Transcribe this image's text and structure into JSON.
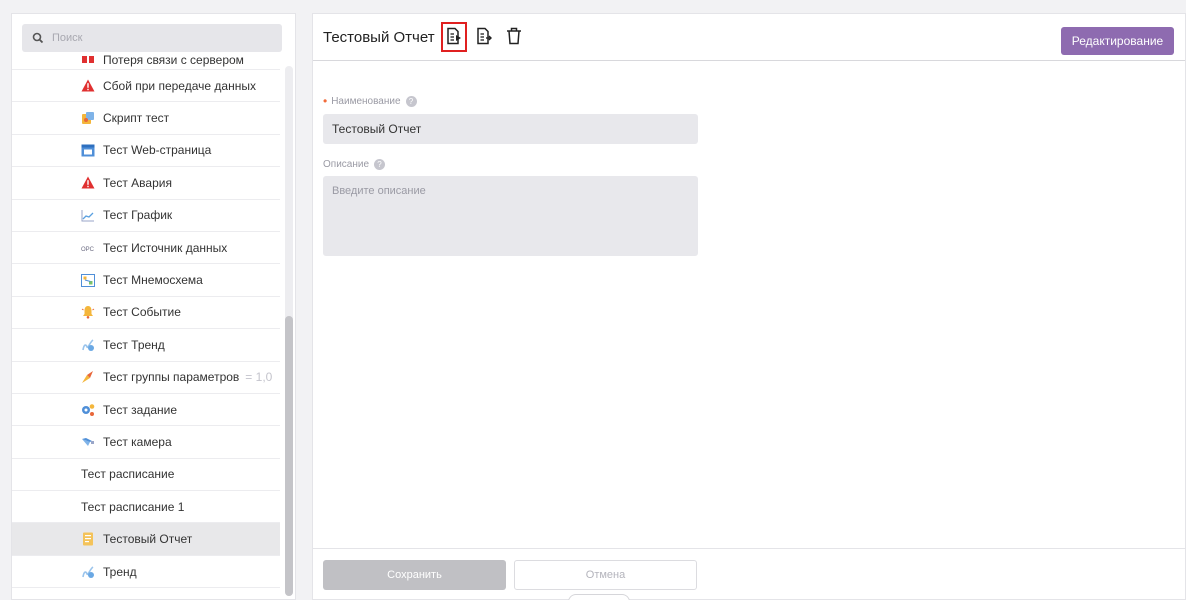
{
  "sidebar": {
    "search": {
      "placeholder": "Поиск",
      "icon": "search-icon"
    },
    "items": [
      {
        "label": "Потеря связи с сервером",
        "icon": "connection-lost-icon",
        "partial": true
      },
      {
        "label": "Сбой при передаче данных",
        "icon": "alarm-icon"
      },
      {
        "label": "Скрипт тест",
        "icon": "script-icon"
      },
      {
        "label": "Тест Web-страница",
        "icon": "web-page-icon"
      },
      {
        "label": "Тест Авария",
        "icon": "alarm-icon"
      },
      {
        "label": "Тест График",
        "icon": "chart-icon"
      },
      {
        "label": "Тест Источник данных",
        "icon": "opc-icon"
      },
      {
        "label": "Тест Мнемосхема",
        "icon": "mnemonic-icon"
      },
      {
        "label": "Тест Событие",
        "icon": "event-icon"
      },
      {
        "label": "Тест Тренд",
        "icon": "trend-icon"
      },
      {
        "label": "Тест группы параметров",
        "icon": "param-group-icon",
        "suffix": "= 1,0"
      },
      {
        "label": "Тест задание",
        "icon": "task-icon"
      },
      {
        "label": "Тест камера",
        "icon": "camera-icon"
      },
      {
        "label": "Тест расписание",
        "icon": ""
      },
      {
        "label": "Тест расписание 1",
        "icon": ""
      },
      {
        "label": "Тестовый Отчет",
        "icon": "report-icon",
        "selected": true
      },
      {
        "label": "Тренд",
        "icon": "trend-icon"
      }
    ]
  },
  "header": {
    "title": "Тестовый Отчет",
    "tools": [
      "export-report-icon",
      "import-report-icon",
      "delete-icon"
    ],
    "edit_label": "Редактирование"
  },
  "form": {
    "name_label": "Наименование",
    "name_value": "Тестовый Отчет",
    "desc_label": "Описание",
    "desc_placeholder": "Введите описание"
  },
  "footer": {
    "save_label": "Сохранить",
    "cancel_label": "Отмена"
  },
  "colors": {
    "accent": "#8e6bb0",
    "required": "#f26b3a",
    "alarm": "#e03030",
    "highlight": "#e02020"
  }
}
